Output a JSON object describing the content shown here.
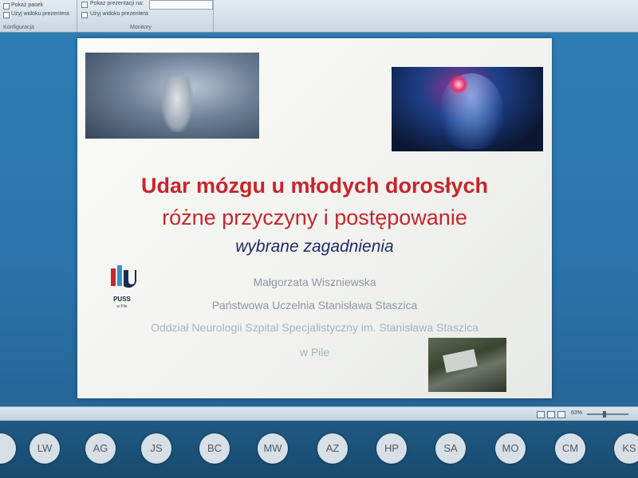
{
  "ribbon": {
    "item1": "Pokaż pasek",
    "item2": "Użyj widoku prezentera",
    "item3": "Pokaz prezentacji na:",
    "item4": "Użyj widoku prezentera",
    "group_left_label": "Konfiguracja",
    "group_monitors_label": "Monitory"
  },
  "slide": {
    "title": "Udar mózgu u młodych dorosłych",
    "subtitle": "różne przyczyny i postępowanie",
    "tagline": "wybrane zagadnienia",
    "author": "Małgorzata Wiszniewska",
    "university": "Państwowa Uczelnia Stanisława Staszica",
    "department": "Oddział Neurologii Szpital Specjalistyczny im. Stanisława Staszica",
    "city": "w Pile",
    "logo_text": "PUSS",
    "logo_subtext": "w Pile",
    "colors": {
      "title": "#c8252e",
      "tagline": "#1f2a6a",
      "body": "#8a96a8"
    }
  },
  "status": {
    "zoom": "63%"
  },
  "participants": [
    "LW",
    "AG",
    "JS",
    "BC",
    "MW",
    "AZ",
    "HP",
    "SA",
    "MO",
    "CM",
    "KS"
  ]
}
